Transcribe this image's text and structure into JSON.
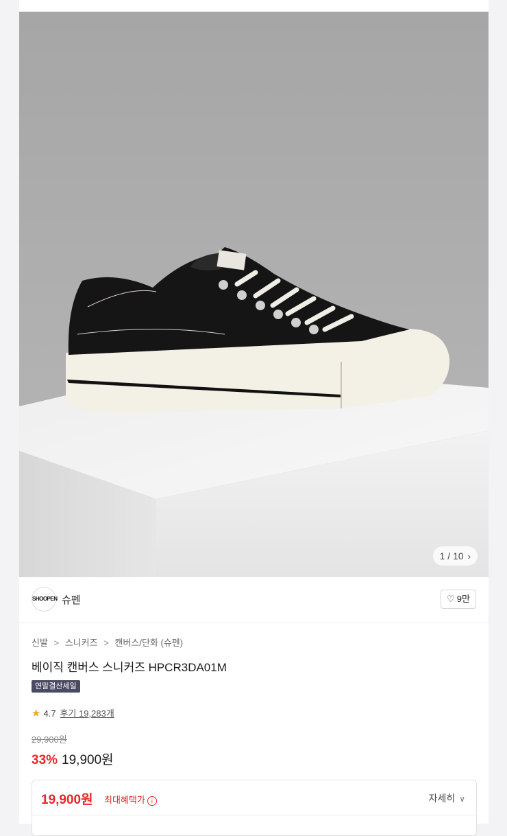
{
  "gallery": {
    "counter_text": "1 / 10",
    "image_alt": "black canvas low-top sneaker with white sole on a white pedestal"
  },
  "brand": {
    "name": "슈펜",
    "logo_text": "SHOOPEN",
    "likes_label": "9만"
  },
  "product": {
    "breadcrumb": [
      "신발",
      "스니커즈",
      "캔버스/단화 (슈펜)"
    ],
    "breadcrumb_sep": ">",
    "title": "베이직 캔버스 스니커즈 HPCR3DA01M",
    "tag": "연말결산세일",
    "rating": "4.7",
    "review_label": "후기 19,283개",
    "original_price": "29,900원",
    "discount": "33%",
    "price": "19,900원"
  },
  "benefit": {
    "price": "19,900원",
    "label": "최대혜택가",
    "info_icon": "i",
    "detail_label": "자세히"
  },
  "colors": {
    "accent_red": "#e8262b",
    "tag_bg": "#4a4a62",
    "star": "#f5a623"
  }
}
